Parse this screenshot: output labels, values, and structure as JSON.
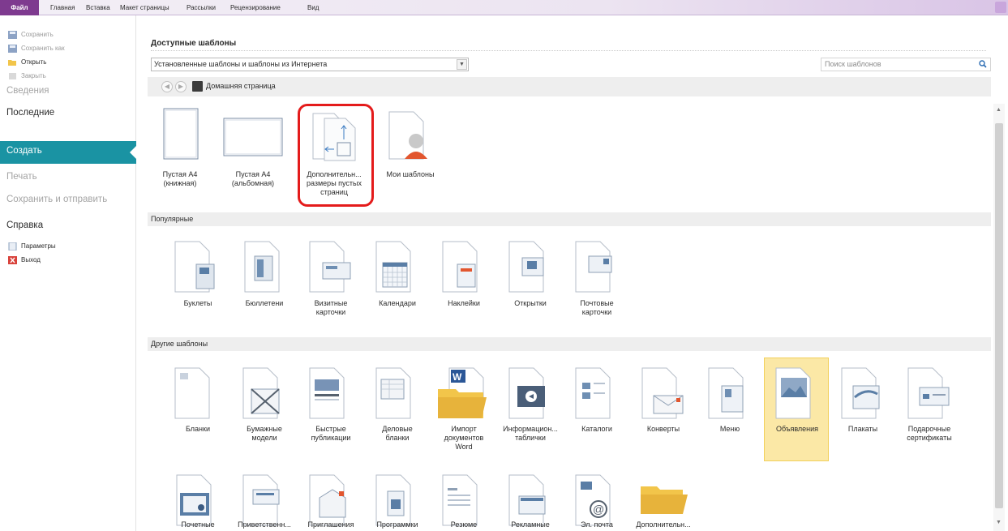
{
  "ribbon": {
    "tabs": [
      "Файл",
      "Главная",
      "Вставка",
      "Макет страницы",
      "Рассылки",
      "Рецензирование",
      "Вид"
    ]
  },
  "sidebar": {
    "small_items": [
      {
        "label": "Сохранить",
        "icon": "save-icon",
        "enabled": false
      },
      {
        "label": "Сохранить как",
        "icon": "save-as-icon",
        "enabled": false
      },
      {
        "label": "Открыть",
        "icon": "folder-open-icon",
        "enabled": true
      },
      {
        "label": "Закрыть",
        "icon": "close-file-icon",
        "enabled": false
      }
    ],
    "info": "Сведения",
    "recent": "Последние",
    "create": "Создать",
    "print": "Печать",
    "save_send": "Сохранить и отправить",
    "help": "Справка",
    "options": "Параметры",
    "exit": "Выход"
  },
  "main": {
    "title": "Доступные шаблоны",
    "source_select": "Установленные шаблоны и шаблоны из Интернета",
    "search_placeholder": "Поиск шаблонов",
    "home_label": "Домашняя страница",
    "top_tiles": [
      {
        "label": "Пустая А4\n(книжная)",
        "icon": "portrait-page-icon"
      },
      {
        "label": "Пустая А4\n(альбомная)",
        "icon": "landscape-page-icon"
      },
      {
        "label": "Дополнительн...\nразмеры пустых\nстраниц",
        "icon": "page-sizes-icon"
      },
      {
        "label": "Мои шаблоны",
        "icon": "my-templates-icon"
      }
    ],
    "popular_header": "Популярные",
    "popular_tiles": [
      {
        "label": "Буклеты"
      },
      {
        "label": "Бюллетени"
      },
      {
        "label": "Визитные\nкарточки"
      },
      {
        "label": "Календари"
      },
      {
        "label": "Наклейки"
      },
      {
        "label": "Открытки"
      },
      {
        "label": "Почтовые\nкарточки"
      }
    ],
    "other_header": "Другие шаблоны",
    "other_tiles": [
      {
        "label": "Бланки"
      },
      {
        "label": "Бумажные\nмодели"
      },
      {
        "label": "Быстрые\nпубликации"
      },
      {
        "label": "Деловые\nбланки"
      },
      {
        "label": "Импорт\nдокументов\nWord"
      },
      {
        "label": "Информацион...\nтаблички"
      },
      {
        "label": "Каталоги"
      },
      {
        "label": "Конверты"
      },
      {
        "label": "Меню"
      },
      {
        "label": "Объявления",
        "selected": true
      },
      {
        "label": "Плакаты"
      },
      {
        "label": "Подарочные\nсертификаты"
      }
    ],
    "bottom_tiles": [
      {
        "label": "Почетные"
      },
      {
        "label": "Приветственн..."
      },
      {
        "label": "Приглашения"
      },
      {
        "label": "Программки"
      },
      {
        "label": "Резюме"
      },
      {
        "label": "Рекламные"
      },
      {
        "label": "Эл. почта"
      },
      {
        "label": "Дополнительн..."
      }
    ]
  },
  "colors": {
    "file_tab": "#7e3a8f",
    "create_accent": "#1a93a3",
    "highlight": "#e41b1b",
    "selected_tile": "#fbe8a6"
  }
}
